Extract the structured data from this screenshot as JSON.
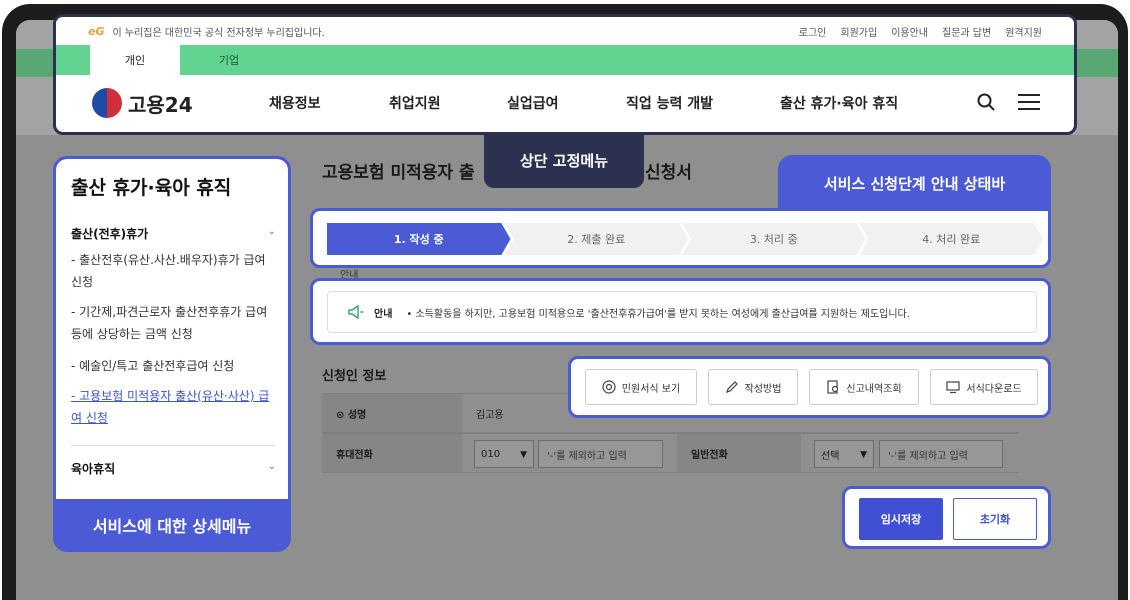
{
  "gov_bar": {
    "logo": "eG",
    "notice": "이 누리집은 대한민국 공식 전자정부 누리집입니다.",
    "links": [
      "로그인",
      "회원가입",
      "이용안내",
      "질문과 답변",
      "원격지원"
    ]
  },
  "tabs": [
    "개인",
    "기업"
  ],
  "header": {
    "logo_text": "고용24",
    "menu": [
      "채용정보",
      "취업지원",
      "실업급여",
      "직업 능력 개발",
      "출산 휴가·육아 휴직"
    ]
  },
  "callouts": {
    "top_menu": "상단 고정메뉴",
    "status_bar": "서비스 신청단계 안내 상태바",
    "side_menu": "서비스에 대한 상세메뉴"
  },
  "sidebar": {
    "title": "출산 휴가·육아 휴직",
    "group1": "출산(전후)휴가",
    "items": [
      "- 출산전후(유산.사산.배우자)휴가 급여 신청",
      "- 기간제,파견근로자 출산전후휴가 급여등에 상당하는 금액 신청",
      "- 예술인/특고 출산전후급여 신청",
      "- 고용보험 미적용자 출산(유산·사산) 급여 신청"
    ],
    "group2": "육아휴직"
  },
  "page": {
    "title_left": "고용보험 미적용자 출",
    "title_right": "신청서"
  },
  "steps": [
    "1. 작성 중",
    "2. 제출 완료",
    "3. 처리 중",
    "4. 처리 완료"
  ],
  "notice": {
    "label": "안내",
    "text": "• 소득활동을 하지만, 고용보험 미적용으로 '출산전후휴가급여'를 받지 못하는 여성에게 출산급여를 지원하는 제도입니다."
  },
  "actions": [
    "민원서식 보기",
    "작성방법",
    "신고내역조회",
    "서식다운로드"
  ],
  "applicant": {
    "section_title": "신청인 정보",
    "name_label": "⊙ 성명",
    "name_value": "김고용",
    "mobile_label": "휴대전화",
    "mobile_prefix": "010",
    "mobile_placeholder": "'-'를 제외하고 입력",
    "phone_label": "일반전화",
    "phone_prefix": "선택",
    "phone_placeholder": "'-'를 제외하고 입력"
  },
  "buttons": {
    "save": "임시저장",
    "reset": "초기화"
  },
  "colors": {
    "accent": "#4b5bd6",
    "green_bar": "#62d390",
    "dark_callout": "#2c3150"
  }
}
